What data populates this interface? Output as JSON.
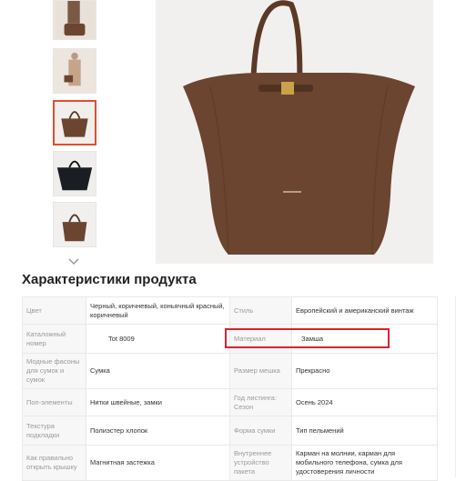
{
  "section_title": "Характеристики продукта",
  "specs": [
    {
      "l1": "Цвет",
      "v1": "Черный, коричневый, коньячный красный, коричневый",
      "l2": "Стиль",
      "v2": "Европейский и американский винтаж"
    },
    {
      "l1": "Каталожный номер",
      "v1": "Tot 8009",
      "l2": "Материал",
      "v2": "Замша"
    },
    {
      "l1": "Модные фасоны для сумок и сумок",
      "v1": "Сумка",
      "l2": "Размер мешка",
      "v2": "Прекрасно"
    },
    {
      "l1": "Поп-элементы",
      "v1": "Нитки швейные, замки",
      "l2": "Год листинга: Сезон",
      "v2": "Осень 2024"
    },
    {
      "l1": "Текстура подкладки",
      "v1": "Полиэстер хлопок",
      "l2": "Форма сумки",
      "v2": "Тип пельмений"
    },
    {
      "l1": "Как правильно открыть крышку",
      "v1": "Магнитная застежка",
      "l2": "Внутреннее устройство пакета",
      "v2": "Карман на молнии, карман для мобильного телефона, сумка для удостоверения личности"
    }
  ],
  "thumbnails": [
    "thumb-woman-with-bag",
    "thumb-woman-in-coat",
    "thumb-brown-bag",
    "thumb-black-bag",
    "thumb-brown-bag-2"
  ],
  "selected_thumbnail": 2,
  "colors": {
    "highlight": "#d9232e",
    "selected_thumb": "#e34e2f",
    "bag": "#6b4530"
  }
}
